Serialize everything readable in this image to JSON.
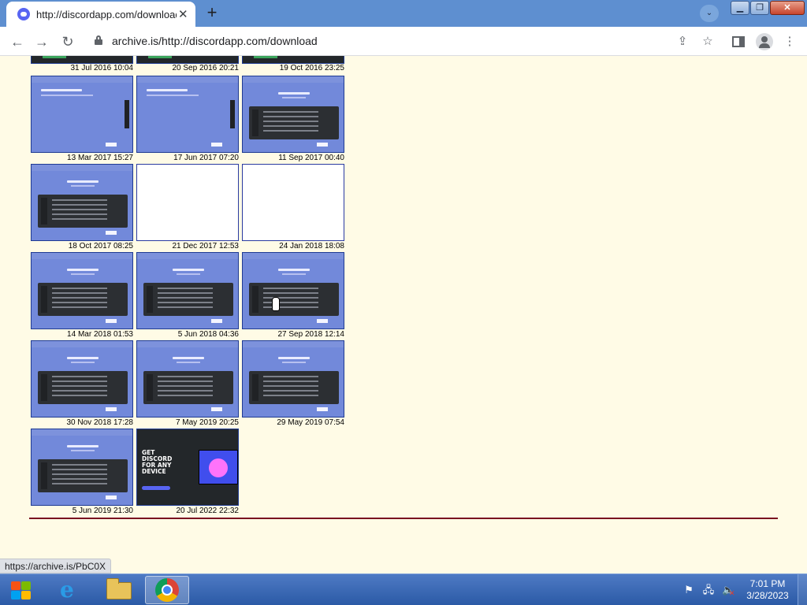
{
  "browser": {
    "tab_title": "http://discordapp.com/download",
    "tab_close": "✕",
    "new_tab": "+",
    "url": "archive.is/http://discordapp.com/download",
    "status_url": "https://archive.is/PbC0X"
  },
  "window_controls": {
    "minimize": "▁",
    "maximize": "❐",
    "close": "✕"
  },
  "toolbar": {
    "back": "←",
    "forward": "→",
    "reload": "↻",
    "share": "⇪",
    "star": "☆",
    "menu": "⋮",
    "tabsearch": "⌄"
  },
  "snapshots_top_row": [
    {
      "date": "31 Jul 2016 10:04"
    },
    {
      "date": "20 Sep 2016 20:21"
    },
    {
      "date": "19 Oct 2016 23:25"
    }
  ],
  "snapshots": [
    {
      "date": "13 Mar 2017 15:27",
      "style": "old"
    },
    {
      "date": "17 Jun 2017 07:20",
      "style": "old"
    },
    {
      "date": "11 Sep 2017 00:40",
      "style": "app"
    },
    {
      "date": "18 Oct 2017 08:25",
      "style": "app"
    },
    {
      "date": "21 Dec 2017 12:53",
      "style": "blank"
    },
    {
      "date": "24 Jan 2018 18:08",
      "style": "blank"
    },
    {
      "date": "14 Mar 2018 01:53",
      "style": "app"
    },
    {
      "date": "5 Jun 2018 04:36",
      "style": "app"
    },
    {
      "date": "27 Sep 2018 12:14",
      "style": "app"
    },
    {
      "date": "30 Nov 2018 17:28",
      "style": "app"
    },
    {
      "date": "7 May 2019 20:25",
      "style": "app"
    },
    {
      "date": "29 May 2019 07:54",
      "style": "app"
    },
    {
      "date": "5 Jun 2019 21:30",
      "style": "app"
    },
    {
      "date": "20 Jul 2022 22:32",
      "style": "dark",
      "headline": "GET DISCORD FOR ANY DEVICE"
    }
  ],
  "taskbar": {
    "apps": [
      {
        "name": "start",
        "icon": "windows-logo-icon"
      },
      {
        "name": "internet-explorer",
        "icon": "ie-icon",
        "glyph": "e"
      },
      {
        "name": "file-explorer",
        "icon": "folder-icon"
      },
      {
        "name": "chrome",
        "icon": "chrome-icon",
        "active": true
      }
    ],
    "tray": {
      "flag": "⚑",
      "network": "🖧",
      "volume": "🔈"
    },
    "clock": {
      "time": "7:01 PM",
      "date": "3/28/2023"
    }
  },
  "colors": {
    "page_bg": "#fffbe6",
    "thumb_blurple": "#7289da",
    "rule": "#7a1020",
    "taskbar": "#2b5aa6"
  }
}
